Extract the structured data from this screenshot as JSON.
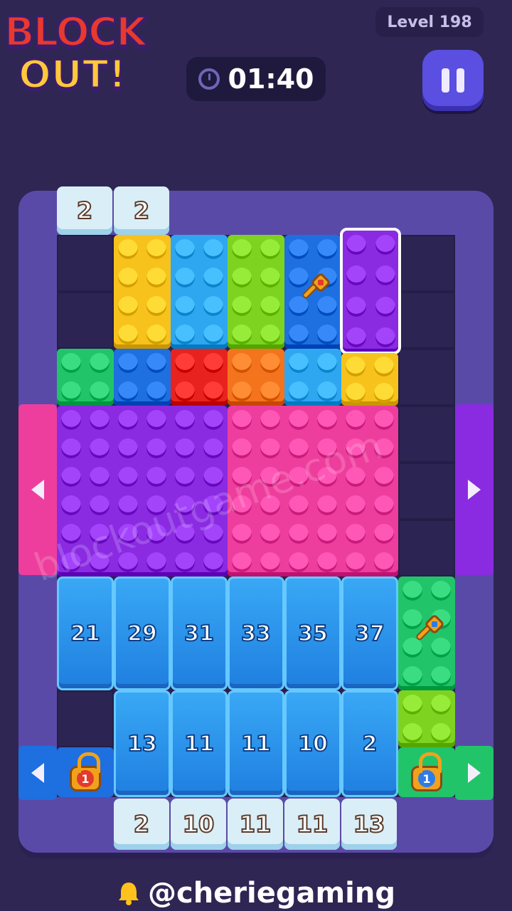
{
  "header": {
    "logo_line1": "BLOCK",
    "logo_line2": "OUT!",
    "level": "Level 198",
    "timer": "01:40"
  },
  "top_gates": [
    "2",
    "2"
  ],
  "ice_row1": [
    "21",
    "29",
    "31",
    "33",
    "35",
    "37"
  ],
  "ice_row2": [
    "13",
    "11",
    "11",
    "10",
    "2"
  ],
  "bottom_gates": [
    "2",
    "10",
    "11",
    "11",
    "13"
  ],
  "locks": {
    "left": "1",
    "right": "1"
  },
  "watermark": "blockoutgame.com",
  "footer": {
    "handle": "@cheriegaming"
  },
  "colors": {
    "yellow": "#f7c21c",
    "light_blue": "#2fa7f0",
    "lime": "#7ed321",
    "blue": "#1e6fe0",
    "purple": "#8a2be2",
    "green": "#22c46a",
    "red": "#e8231f",
    "orange": "#f4741d",
    "magenta": "#ee3e9d"
  }
}
